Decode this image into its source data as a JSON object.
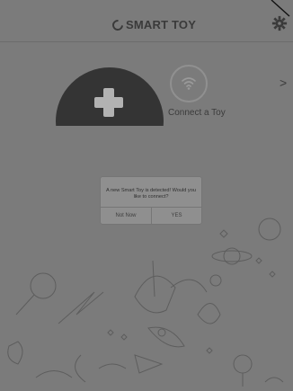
{
  "header": {
    "logo_text": "SMART TOY",
    "settings_icon": "gear-icon"
  },
  "connect": {
    "add_icon": "plus-icon",
    "wifi_icon": "wifi-icon",
    "label": "Connect a Toy",
    "chevron": ">"
  },
  "dialog": {
    "message": "A new Smart Toy is detected! Would you like to connect?",
    "cancel_label": "Not Now",
    "confirm_label": "YES"
  },
  "colors": {
    "overlay": "#7b7b7b",
    "dark_button": "#343434",
    "text": "#3b3b3b"
  }
}
